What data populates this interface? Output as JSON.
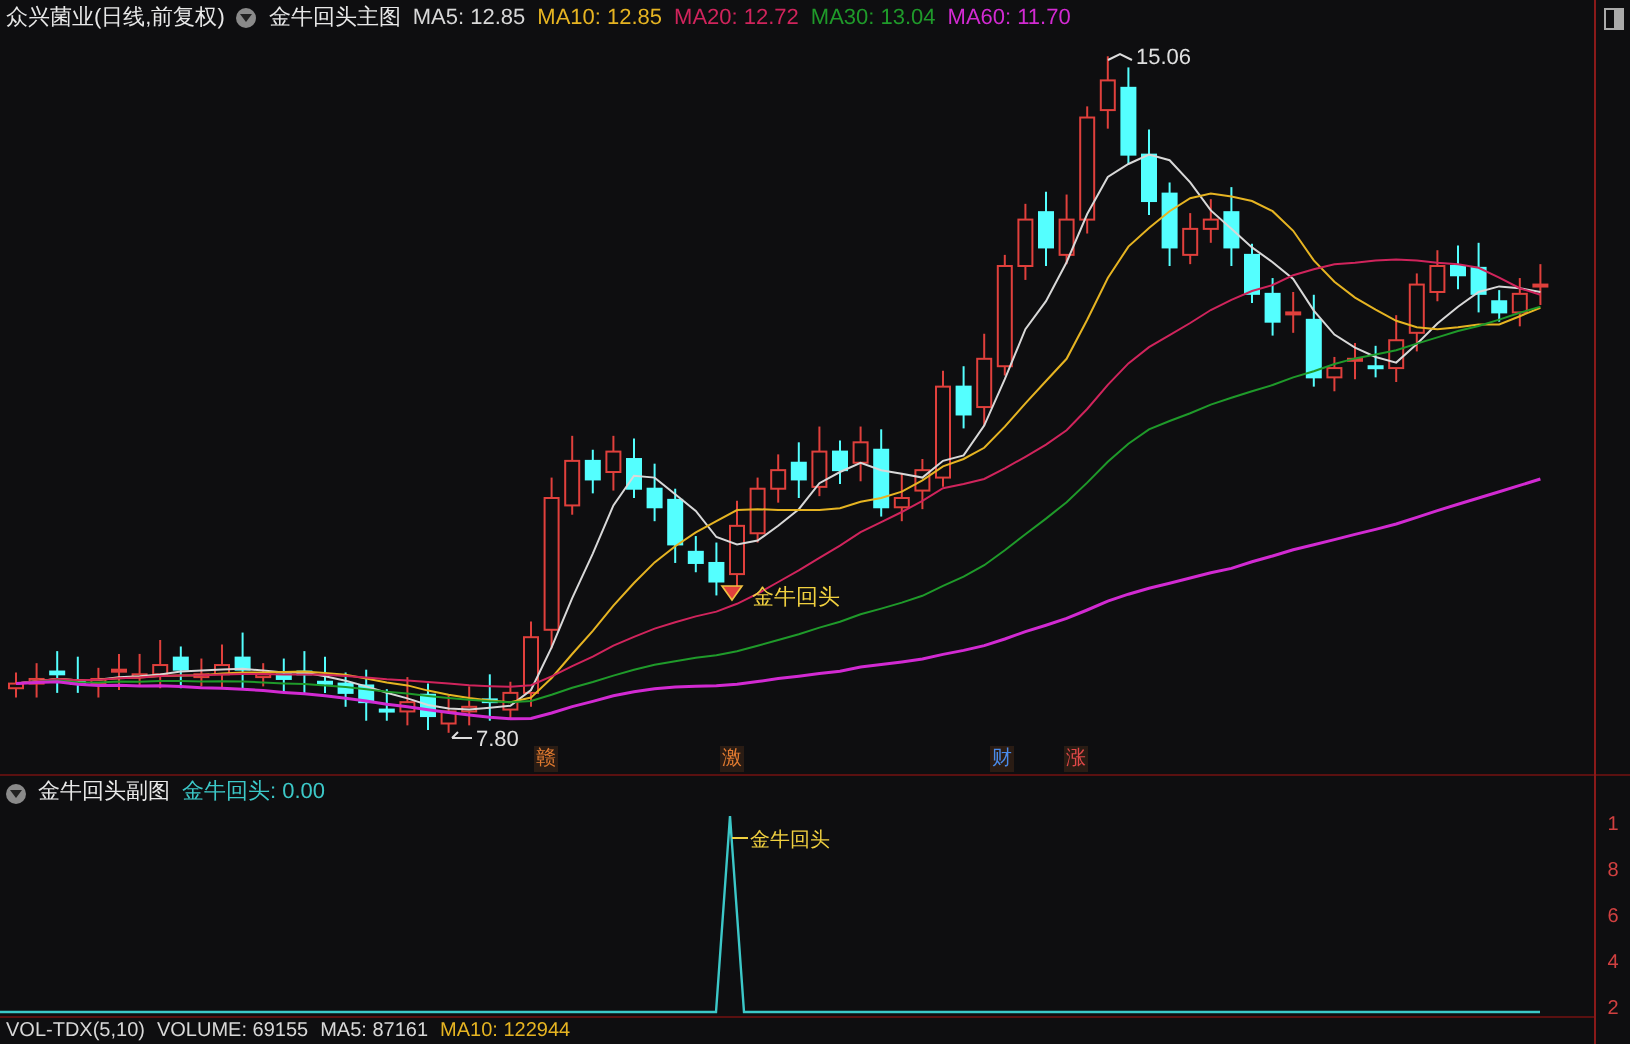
{
  "header": {
    "title": "众兴菌业(日线,前复权)",
    "indicator": "金牛回头主图",
    "ma": [
      {
        "label": "MA5: 12.85",
        "color": "#d8d8d8"
      },
      {
        "label": "MA10: 12.85",
        "color": "#e6b422"
      },
      {
        "label": "MA20: 12.72",
        "color": "#d0245c"
      },
      {
        "label": "MA30: 13.04",
        "color": "#1f9a2a"
      },
      {
        "label": "MA60: 11.70",
        "color": "#d22ad2"
      }
    ]
  },
  "main_chart": {
    "high_label": "15.06",
    "low_label": "7.80",
    "signal_label": "金牛回头"
  },
  "markers": [
    {
      "text": "赣",
      "color": "#e07a30"
    },
    {
      "text": "激",
      "color": "#e07a30"
    },
    {
      "text": "财",
      "color": "#4a8ae8"
    },
    {
      "text": "涨",
      "color": "#e04848"
    }
  ],
  "sub_chart": {
    "title": "金牛回头副图",
    "reading": "金牛回头: 0.00",
    "signal_label": "金牛回头",
    "axis_labels": [
      "1",
      "8",
      "6",
      "4",
      "2"
    ]
  },
  "volume_bar": {
    "name": "VOL-TDX(5,10)",
    "items": [
      {
        "label": "VOLUME: 69155",
        "color": "#d8d8d8"
      },
      {
        "label": "MA5: 87161",
        "color": "#d8d8d8"
      },
      {
        "label": "MA10: 122944",
        "color": "#e6b422"
      }
    ]
  }
}
